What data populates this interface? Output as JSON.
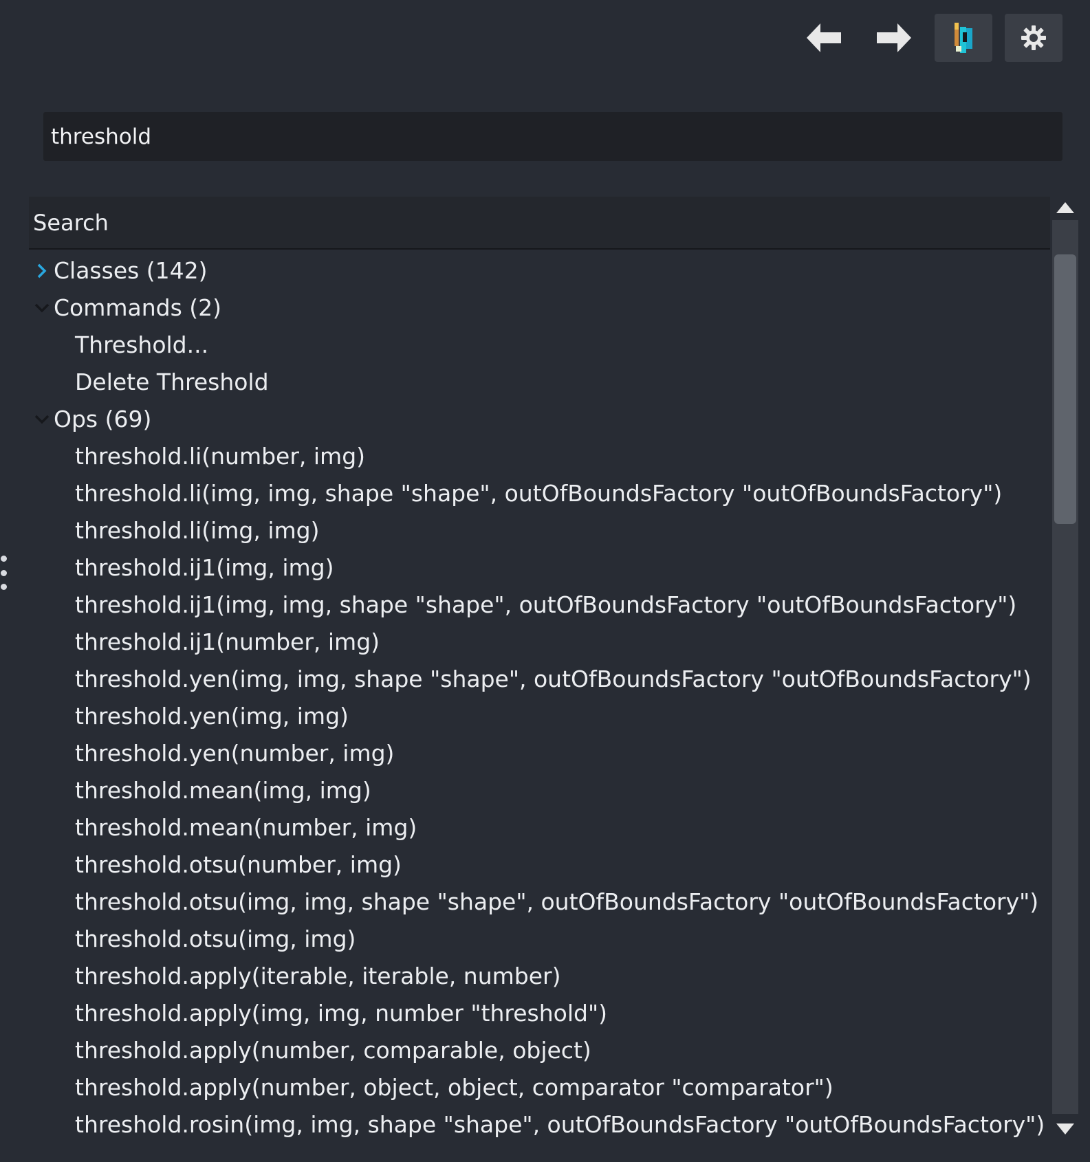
{
  "toolbar": {
    "back_icon": "arrow-left-icon",
    "forward_icon": "arrow-right-icon",
    "logo_icon": "imagej-logo-icon",
    "settings_icon": "gear-icon"
  },
  "search": {
    "value": "threshold"
  },
  "results": {
    "header": "Search",
    "groups": [
      {
        "label": "Classes (142)",
        "expanded": false,
        "items": []
      },
      {
        "label": "Commands (2)",
        "expanded": true,
        "items": [
          "Threshold...",
          "Delete Threshold"
        ]
      },
      {
        "label": "Ops (69)",
        "expanded": true,
        "items": [
          "threshold.li(number, img)",
          "threshold.li(img, img, shape \"shape\", outOfBoundsFactory \"outOfBoundsFactory\")",
          "threshold.li(img, img)",
          "threshold.ij1(img, img)",
          "threshold.ij1(img, img, shape \"shape\", outOfBoundsFactory \"outOfBoundsFactory\")",
          "threshold.ij1(number, img)",
          "threshold.yen(img, img, shape \"shape\", outOfBoundsFactory \"outOfBoundsFactory\")",
          "threshold.yen(img, img)",
          "threshold.yen(number, img)",
          "threshold.mean(img, img)",
          "threshold.mean(number, img)",
          "threshold.otsu(number, img)",
          "threshold.otsu(img, img, shape \"shape\", outOfBoundsFactory \"outOfBoundsFactory\")",
          "threshold.otsu(img, img)",
          "threshold.apply(iterable, iterable, number)",
          "threshold.apply(img, img, number \"threshold\")",
          "threshold.apply(number, comparable, object)",
          "threshold.apply(number, object, object, comparator \"comparator\")",
          "threshold.rosin(img, img, shape \"shape\", outOfBoundsFactory \"outOfBoundsFactory\")"
        ]
      }
    ]
  },
  "colors": {
    "background": "#282c34",
    "field": "#1f2126",
    "chevron_collapsed": "#29a8e0",
    "chevron_expanded": "#16181c",
    "text": "#eceef1"
  }
}
